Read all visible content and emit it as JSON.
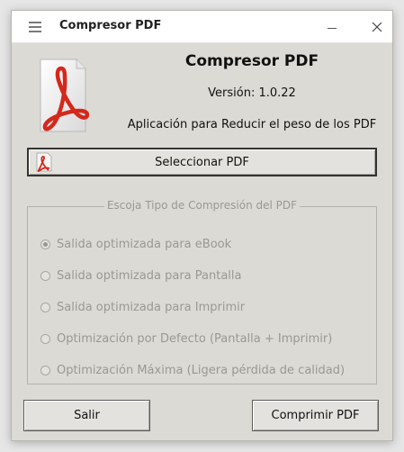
{
  "window": {
    "title": "Compresor PDF"
  },
  "header": {
    "app_name": "Compresor PDF",
    "version": "Versión: 1.0.22",
    "description": "Aplicación para Reducir el peso de los PDF"
  },
  "actions": {
    "select_label": "Seleccionar PDF",
    "exit_label": "Salir",
    "compress_label": "Comprimir PDF"
  },
  "compression": {
    "group_title": "Escoja Tipo de Compresión del PDF",
    "options": [
      {
        "label": "Salida optimizada para eBook",
        "checked": true
      },
      {
        "label": "Salida optimizada para Pantalla",
        "checked": false
      },
      {
        "label": "Salida optimizada para Imprimir",
        "checked": false
      },
      {
        "label": "Optimización por Defecto (Pantalla + Imprimir)",
        "checked": false
      },
      {
        "label": "Optimización Máxima (Ligera pérdida de calidad)",
        "checked": false
      }
    ],
    "enabled": false
  },
  "icons": {
    "menu": "hamburger-menu-icon",
    "minimize": "minimize-icon",
    "close": "close-icon",
    "logo": "pdf-document-icon"
  },
  "colors": {
    "pdf_red": "#d4281c",
    "window_bg": "#dcdad5",
    "disabled_text": "#9a9894"
  }
}
